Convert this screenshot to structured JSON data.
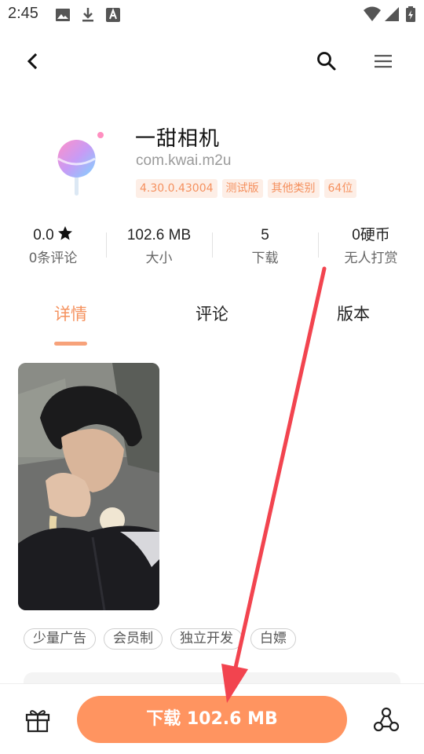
{
  "status_bar": {
    "time": "2:45",
    "left_icons": [
      "image-icon",
      "download-icon",
      "text-a-icon"
    ],
    "right_icons": [
      "wifi-icon",
      "signal-icon",
      "battery-charging-icon"
    ]
  },
  "nav": {
    "back_icon": "chevron-left-icon",
    "search_icon": "search-icon",
    "menu_icon": "menu-icon"
  },
  "app": {
    "name": "一甜相机",
    "package": "com.kwai.m2u",
    "tags": [
      "4.30.0.43004",
      "测试版",
      "其他类别",
      "64位"
    ]
  },
  "stats": [
    {
      "value": "0.0",
      "label": "0条评论",
      "icon": "star-icon"
    },
    {
      "value": "102.6 MB",
      "label": "大小"
    },
    {
      "value": "5",
      "label": "下载"
    },
    {
      "value": "0硬币",
      "label": "无人打赏"
    }
  ],
  "tabs": [
    {
      "label": "详情",
      "active": true
    },
    {
      "label": "评论",
      "active": false
    },
    {
      "label": "版本",
      "active": false
    }
  ],
  "feature_tags": [
    "少量广告",
    "会员制",
    "独立开发",
    "白嫖"
  ],
  "bottom": {
    "gift_icon": "gift-icon",
    "download_label": "下载 102.6 MB",
    "share_icon": "share-icon"
  },
  "colors": {
    "accent": "#ff9460",
    "tag_bg": "#fdeee6",
    "tag_text": "#f5915f",
    "annotation_arrow": "#f2444f"
  }
}
